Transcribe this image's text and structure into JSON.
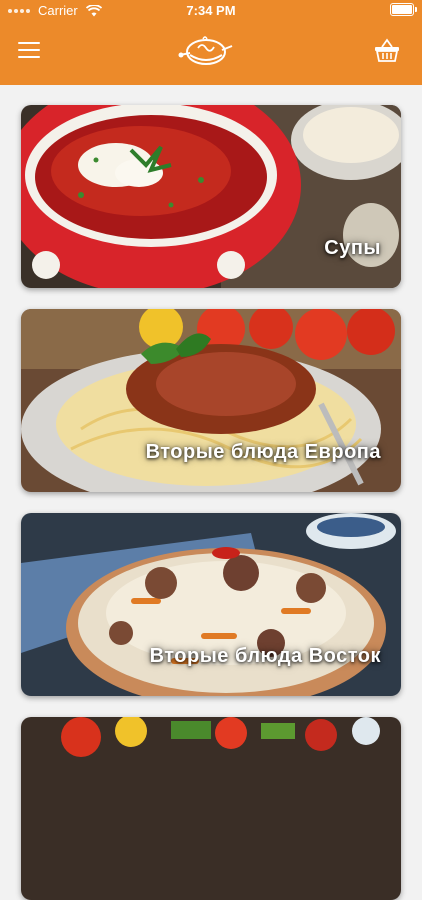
{
  "status_bar": {
    "carrier": "Carrier",
    "time": "7:34 PM"
  },
  "header": {
    "menu_icon": "hamburger-menu-icon",
    "logo_icon": "bowl-logo-icon",
    "cart_icon": "basket-icon"
  },
  "colors": {
    "header": "#ec8a2a",
    "background": "#f2f2f2"
  },
  "categories": [
    {
      "label": "Супы"
    },
    {
      "label": "Вторые блюда Европа"
    },
    {
      "label": "Вторые блюда Восток"
    },
    {
      "label": ""
    }
  ]
}
